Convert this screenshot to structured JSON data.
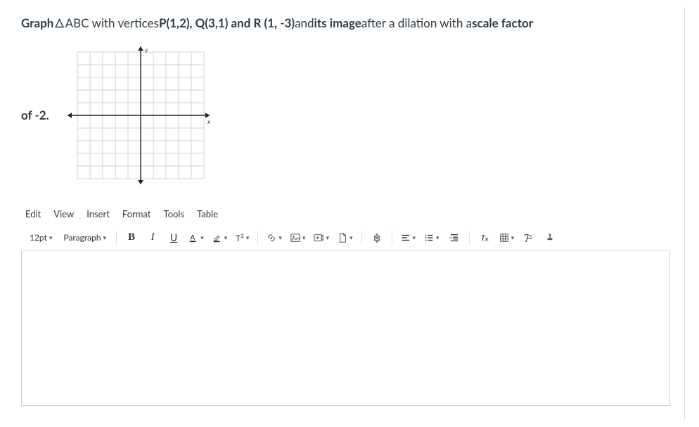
{
  "prompt": {
    "p1": "Graph ",
    "tri": "△",
    "p2": " ABC with vertices ",
    "p3": "P(1,2), Q(3,1) and R (1, -3)",
    "p4": " and ",
    "p5": "its image",
    "p6": " after a dilation with a ",
    "p7": "scale factor"
  },
  "of_label": "of -2.",
  "axes": {
    "x": "x",
    "y": "y"
  },
  "menubar": [
    "Edit",
    "View",
    "Insert",
    "Format",
    "Tools",
    "Table"
  ],
  "toolbar": {
    "fontsize": "12pt",
    "blockformat": "Paragraph",
    "bold": "B",
    "italic": "I",
    "underline": "U",
    "super": "T²"
  },
  "editor_content": ""
}
